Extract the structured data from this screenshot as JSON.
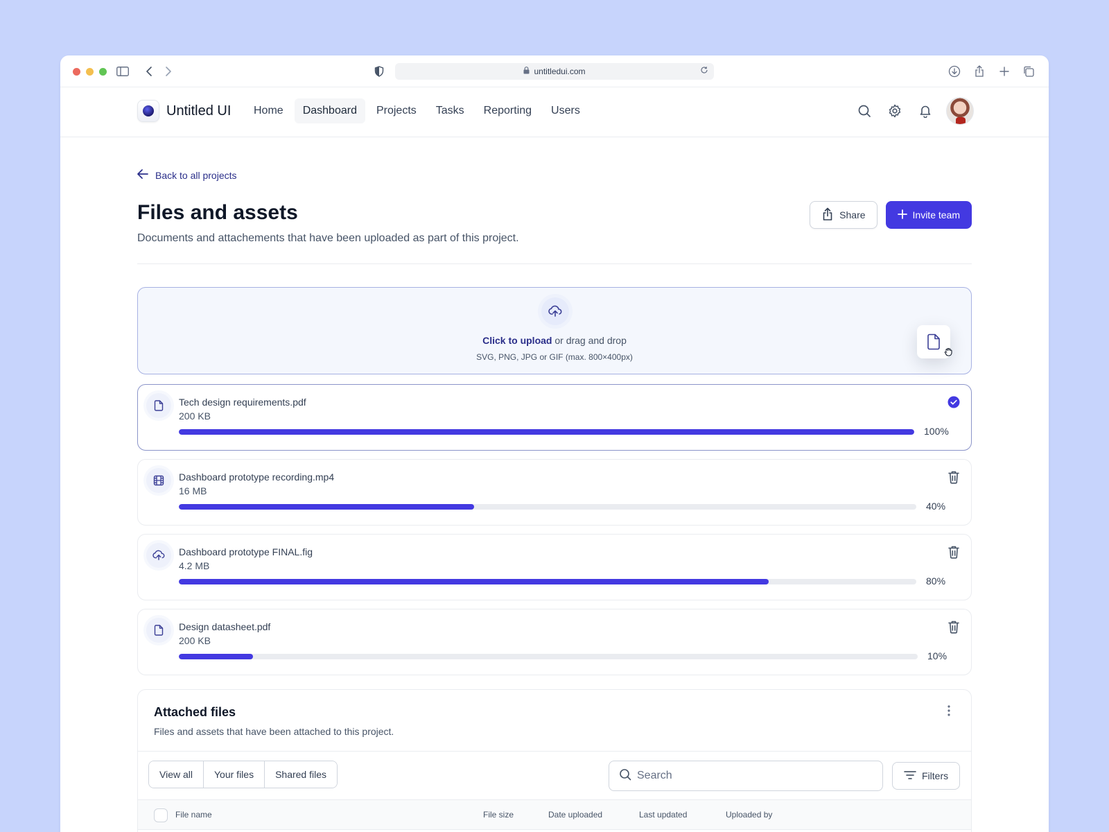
{
  "browser": {
    "url": "untitledui.com",
    "traffic_colors": [
      "#ec6a5e",
      "#f4bf4f",
      "#61c554"
    ]
  },
  "app": {
    "brand": "Untitled UI",
    "nav": [
      {
        "label": "Home",
        "active": false
      },
      {
        "label": "Dashboard",
        "active": true
      },
      {
        "label": "Projects",
        "active": false
      },
      {
        "label": "Tasks",
        "active": false
      },
      {
        "label": "Reporting",
        "active": false
      },
      {
        "label": "Users",
        "active": false
      }
    ],
    "icons": [
      "search-icon",
      "settings-icon",
      "bell-icon"
    ]
  },
  "page": {
    "back_link": "Back to all projects",
    "title": "Files and assets",
    "subtitle": "Documents and attachements that have been uploaded as part of this project.",
    "share_label": "Share",
    "invite_label": "Invite team"
  },
  "upload": {
    "cta": "Click to upload",
    "rest": " or drag and drop",
    "hint": "SVG, PNG, JPG or GIF (max. 800×400px)"
  },
  "files": [
    {
      "name": "Tech design requirements.pdf",
      "size": "200 KB",
      "progress": 100,
      "progress_label": "100%",
      "icon": "file-icon",
      "status": "complete"
    },
    {
      "name": "Dashboard prototype recording.mp4",
      "size": "16 MB",
      "progress": 40,
      "progress_label": "40%",
      "icon": "film-icon",
      "status": "uploading"
    },
    {
      "name": "Dashboard prototype FINAL.fig",
      "size": "4.2 MB",
      "progress": 80,
      "progress_label": "80%",
      "icon": "upload-cloud-icon",
      "status": "uploading"
    },
    {
      "name": "Design datasheet.pdf",
      "size": "200 KB",
      "progress": 10,
      "progress_label": "10%",
      "icon": "file-icon",
      "status": "uploading"
    }
  ],
  "attached": {
    "title": "Attached files",
    "subtitle": "Files and assets that have been attached to this project.",
    "tabs": [
      "View all",
      "Your files",
      "Shared files"
    ],
    "search_placeholder": "Search",
    "filters_label": "Filters",
    "columns": [
      "File name",
      "File size",
      "Date uploaded",
      "Last updated",
      "Uploaded by"
    ]
  },
  "colors": {
    "accent": "#4339e1",
    "background": "#c7d4fc",
    "link": "#2b2f8a"
  }
}
